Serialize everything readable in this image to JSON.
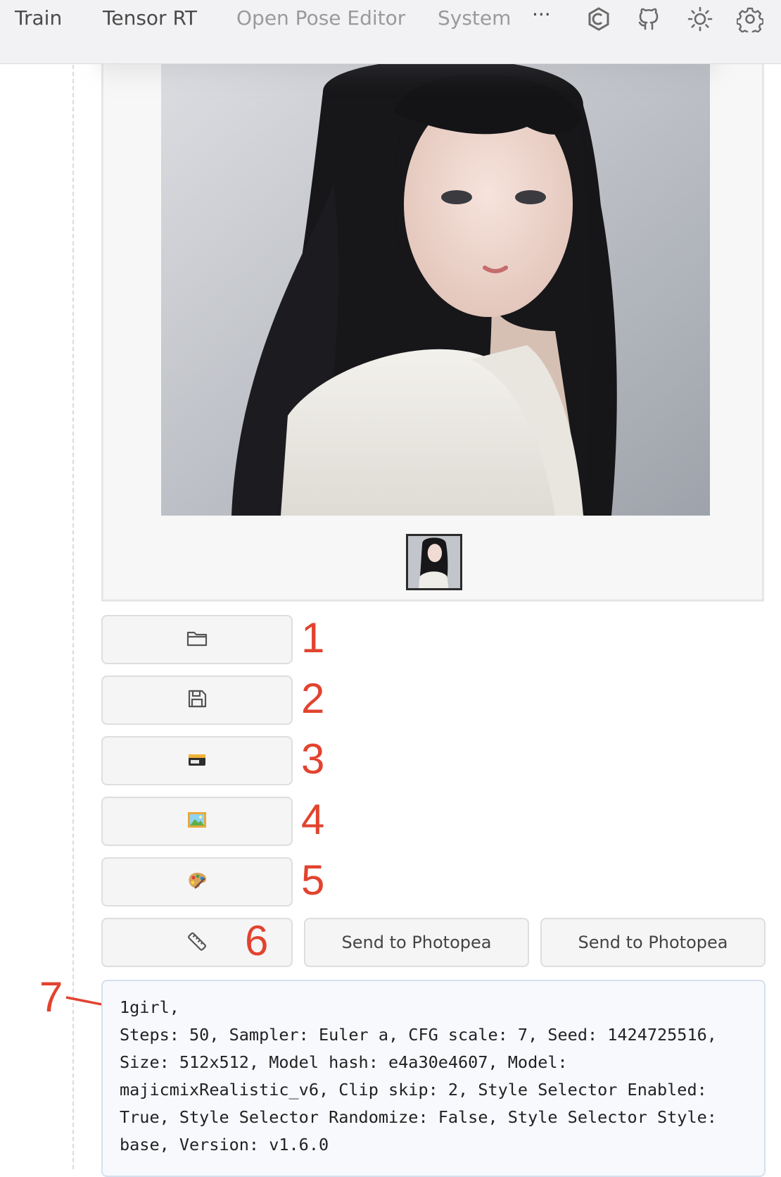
{
  "nav": {
    "tabs": [
      "Train",
      "Tensor RT",
      "Open Pose Editor",
      "System"
    ],
    "more": "···",
    "icons": [
      "extension-hex-icon",
      "github-icon",
      "theme-sun-icon",
      "settings-gear-icon"
    ]
  },
  "tools": [
    {
      "icon": "folder-icon",
      "marker": "1"
    },
    {
      "icon": "save-icon",
      "marker": "2"
    },
    {
      "icon": "archive-box-icon",
      "marker": "3"
    },
    {
      "icon": "framed-picture-icon",
      "marker": "4"
    },
    {
      "icon": "palette-icon",
      "marker": "5"
    },
    {
      "icon": "ruler-icon",
      "marker": "6"
    }
  ],
  "send_buttons": [
    "Send to Photopea",
    "Send to Photopea"
  ],
  "info": {
    "marker": "7",
    "prompt": "1girl,",
    "params": "Steps: 50, Sampler: Euler a, CFG scale: 7, Seed: 1424725516, Size: 512x512, Model hash: e4a30e4607, Model: majicmixRealistic_v6, Clip skip: 2, Style Selector Enabled: True, Style Selector Randomize: False, Style Selector Style: base, Version: v1.6.0"
  },
  "colors": {
    "annotation": "#e2432f",
    "panel_bg": "#f7f9fd",
    "nav_bg": "#f2f2f4"
  }
}
